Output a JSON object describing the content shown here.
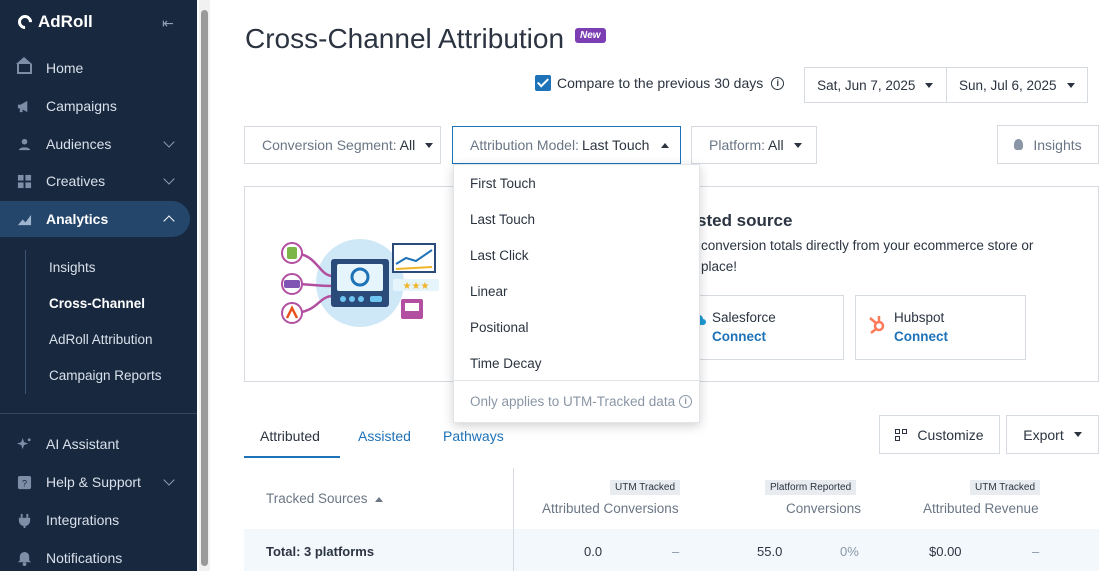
{
  "app": {
    "brand": "AdRoll"
  },
  "sidebar": {
    "items": [
      {
        "label": "Home"
      },
      {
        "label": "Campaigns"
      },
      {
        "label": "Audiences"
      },
      {
        "label": "Creatives"
      },
      {
        "label": "Analytics"
      }
    ],
    "analytics_sub": [
      {
        "label": "Insights"
      },
      {
        "label": "Cross-Channel"
      },
      {
        "label": "AdRoll Attribution"
      },
      {
        "label": "Campaign Reports"
      }
    ],
    "bottom_items": [
      {
        "label": "AI Assistant"
      },
      {
        "label": "Help & Support"
      },
      {
        "label": "Integrations"
      },
      {
        "label": "Notifications"
      }
    ]
  },
  "header": {
    "title": "Cross-Channel Attribution",
    "badge": "New",
    "compare_label": "Compare to the previous 30 days",
    "start_date": "Sat, Jun 7, 2025",
    "end_date": "Sun, Jul 6, 2025"
  },
  "filters": {
    "segment_label": "Conversion Segment:",
    "segment_value": "All",
    "model_label": "Attribution Model:",
    "model_value": "Last Touch",
    "platform_label": "Platform:",
    "platform_value": "All",
    "insights_label": "Insights"
  },
  "dropdown": {
    "options": [
      "First Touch",
      "Last Touch",
      "Last Click",
      "Linear",
      "Positional",
      "Time Decay"
    ],
    "note": "Only applies to UTM-Tracked data"
  },
  "card": {
    "title_partial": "sted source",
    "text_line1": "conversion totals directly from your ecommerce store or",
    "text_line2": "place!",
    "salesforce": {
      "name": "Salesforce",
      "link": "Connect"
    },
    "hubspot": {
      "name": "Hubspot",
      "link": "Connect"
    }
  },
  "tabs": [
    "Attributed",
    "Assisted",
    "Pathways"
  ],
  "actions": {
    "customize": "Customize",
    "export": "Export"
  },
  "table": {
    "sources_header": "Tracked Sources",
    "columns": [
      {
        "chip": "UTM Tracked",
        "label": "Attributed Conversions"
      },
      {
        "chip": "Platform Reported",
        "label": "Conversions"
      },
      {
        "chip": "UTM Tracked",
        "label": "Attributed Revenue"
      }
    ],
    "total_row": {
      "label": "Total: 3 platforms",
      "attributed_conversions": "0.0",
      "attributed_conversions_delta": "–",
      "conversions": "55.0",
      "conversions_delta": "0%",
      "revenue": "$0.00",
      "revenue_delta": "–"
    }
  },
  "colors": {
    "sidebar_bg": "#17283f",
    "accent": "#1d72b8",
    "badge": "#7b3fb3"
  }
}
